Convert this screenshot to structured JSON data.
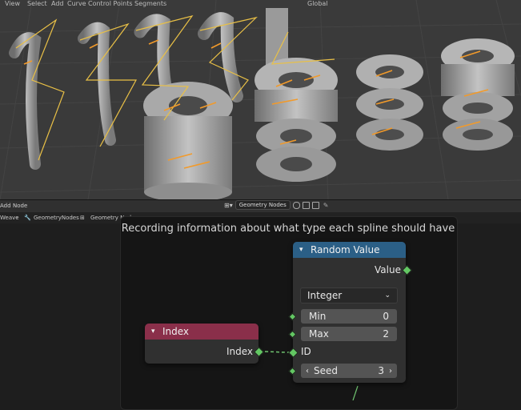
{
  "viewport": {
    "top_items": [
      "View",
      "Select",
      "Add",
      "Curve",
      "Control Points",
      "Segments"
    ],
    "shading_label": "Global"
  },
  "editor_header": {
    "add_menu": "Add",
    "node_menu": "Node",
    "tree_name": "Geometry Nodes"
  },
  "breadcrumbs": [
    "Weave",
    "GeometryNodes",
    "Geometry Nodes"
  ],
  "frame": {
    "label": "Recording information about what type each spline should have"
  },
  "index_node": {
    "title": "Index",
    "output_label": "Index",
    "header_color": "#8a2f4a"
  },
  "random_node": {
    "title": "Random Value",
    "header_color": "#2b5f86",
    "output_label": "Value",
    "data_type": "Integer",
    "min_label": "Min",
    "min_value": "0",
    "max_label": "Max",
    "max_value": "2",
    "id_label": "ID",
    "seed_label": "Seed",
    "seed_value": "3"
  },
  "colors": {
    "socket_green": "#63c763",
    "frame_bg": "#151515",
    "link_color": "#6fc26f"
  },
  "icons": [
    "wrench-icon",
    "node-tree-icon",
    "chevron-down-icon",
    "pin-icon",
    "shield-icon",
    "copy-icon",
    "close-icon"
  ]
}
